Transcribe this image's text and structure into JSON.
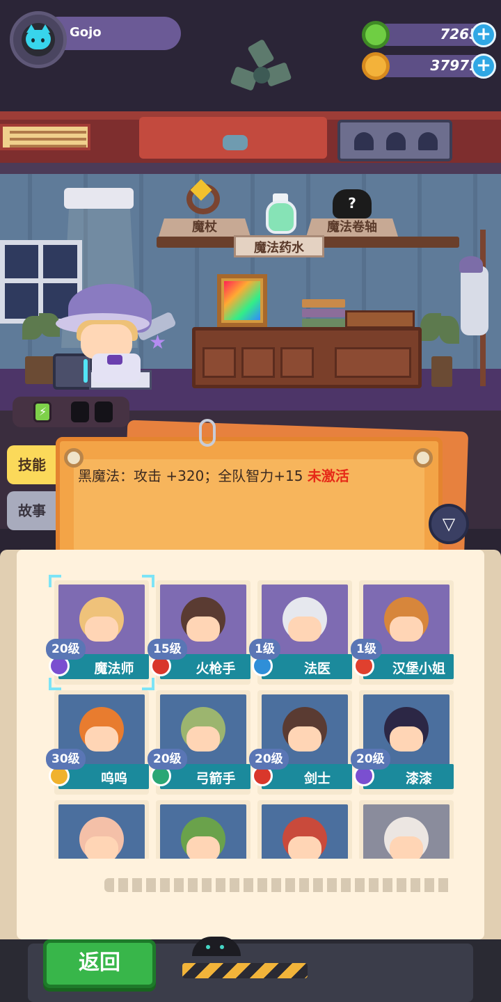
{
  "player": {
    "name": "Gojo",
    "avatar_icon": "cat-icon"
  },
  "currencies": [
    {
      "name": "gem-coin",
      "value": "7265",
      "icon": "green-ring-coin-icon",
      "color": "#6fce43"
    },
    {
      "name": "gold-planet",
      "value": "37971",
      "icon": "planet-coin-icon",
      "color": "#f3b23a"
    }
  ],
  "shelf": {
    "staff": "魔杖",
    "potion": "魔法药水",
    "scroll": "魔法卷轴",
    "scroll_unknown": "?"
  },
  "battery": {
    "charged_cells": 1,
    "total_cells": 3
  },
  "tabs": {
    "skill": "技能",
    "story": "故事"
  },
  "skill": {
    "text": "黑魔法：攻击 +320；全队智力+15",
    "status": "未激活"
  },
  "characters": [
    {
      "name": "魔法师",
      "level": "20级",
      "class_color": "#7a4fd0",
      "bg": "#7e6bb2",
      "hair": "#efc27a",
      "selected": true
    },
    {
      "name": "火枪手",
      "level": "15级",
      "class_color": "#d9372b",
      "bg": "#7e6bb2",
      "hair": "#5a3b32",
      "selected": false
    },
    {
      "name": "法医",
      "level": "1级",
      "class_color": "#2f8fd8",
      "bg": "#7e6bb2",
      "hair": "#e6e8ee",
      "selected": false
    },
    {
      "name": "汉堡小姐",
      "level": "1级",
      "class_color": "#e0402e",
      "bg": "#7e6bb2",
      "hair": "#d7863b",
      "selected": false
    },
    {
      "name": "呜呜",
      "level": "30级",
      "class_color": "#f0b22d",
      "bg": "#4b6f9e",
      "hair": "#e87c2f",
      "selected": false
    },
    {
      "name": "弓箭手",
      "level": "20级",
      "class_color": "#2aa775",
      "bg": "#4b6f9e",
      "hair": "#9cb56f",
      "selected": false
    },
    {
      "name": "剑士",
      "level": "20级",
      "class_color": "#d9372b",
      "bg": "#4b6f9e",
      "hair": "#5a3b32",
      "selected": false
    },
    {
      "name": "漆漆",
      "level": "20级",
      "class_color": "#7a4fd0",
      "bg": "#4b6f9e",
      "hair": "#2c2745",
      "selected": false
    },
    {
      "name": "",
      "level": "",
      "class_color": "",
      "bg": "#4b6f9e",
      "hair": "#f4c0a8",
      "selected": false
    },
    {
      "name": "",
      "level": "",
      "class_color": "",
      "bg": "#4b6f9e",
      "hair": "#6aa24b",
      "selected": false
    },
    {
      "name": "",
      "level": "",
      "class_color": "",
      "bg": "#4b6f9e",
      "hair": "#c94a3b",
      "selected": false
    },
    {
      "name": "",
      "level": "",
      "class_color": "",
      "bg": "#8a8c9c",
      "hair": "#ece6e2",
      "selected": false
    }
  ],
  "back_button": "返回"
}
